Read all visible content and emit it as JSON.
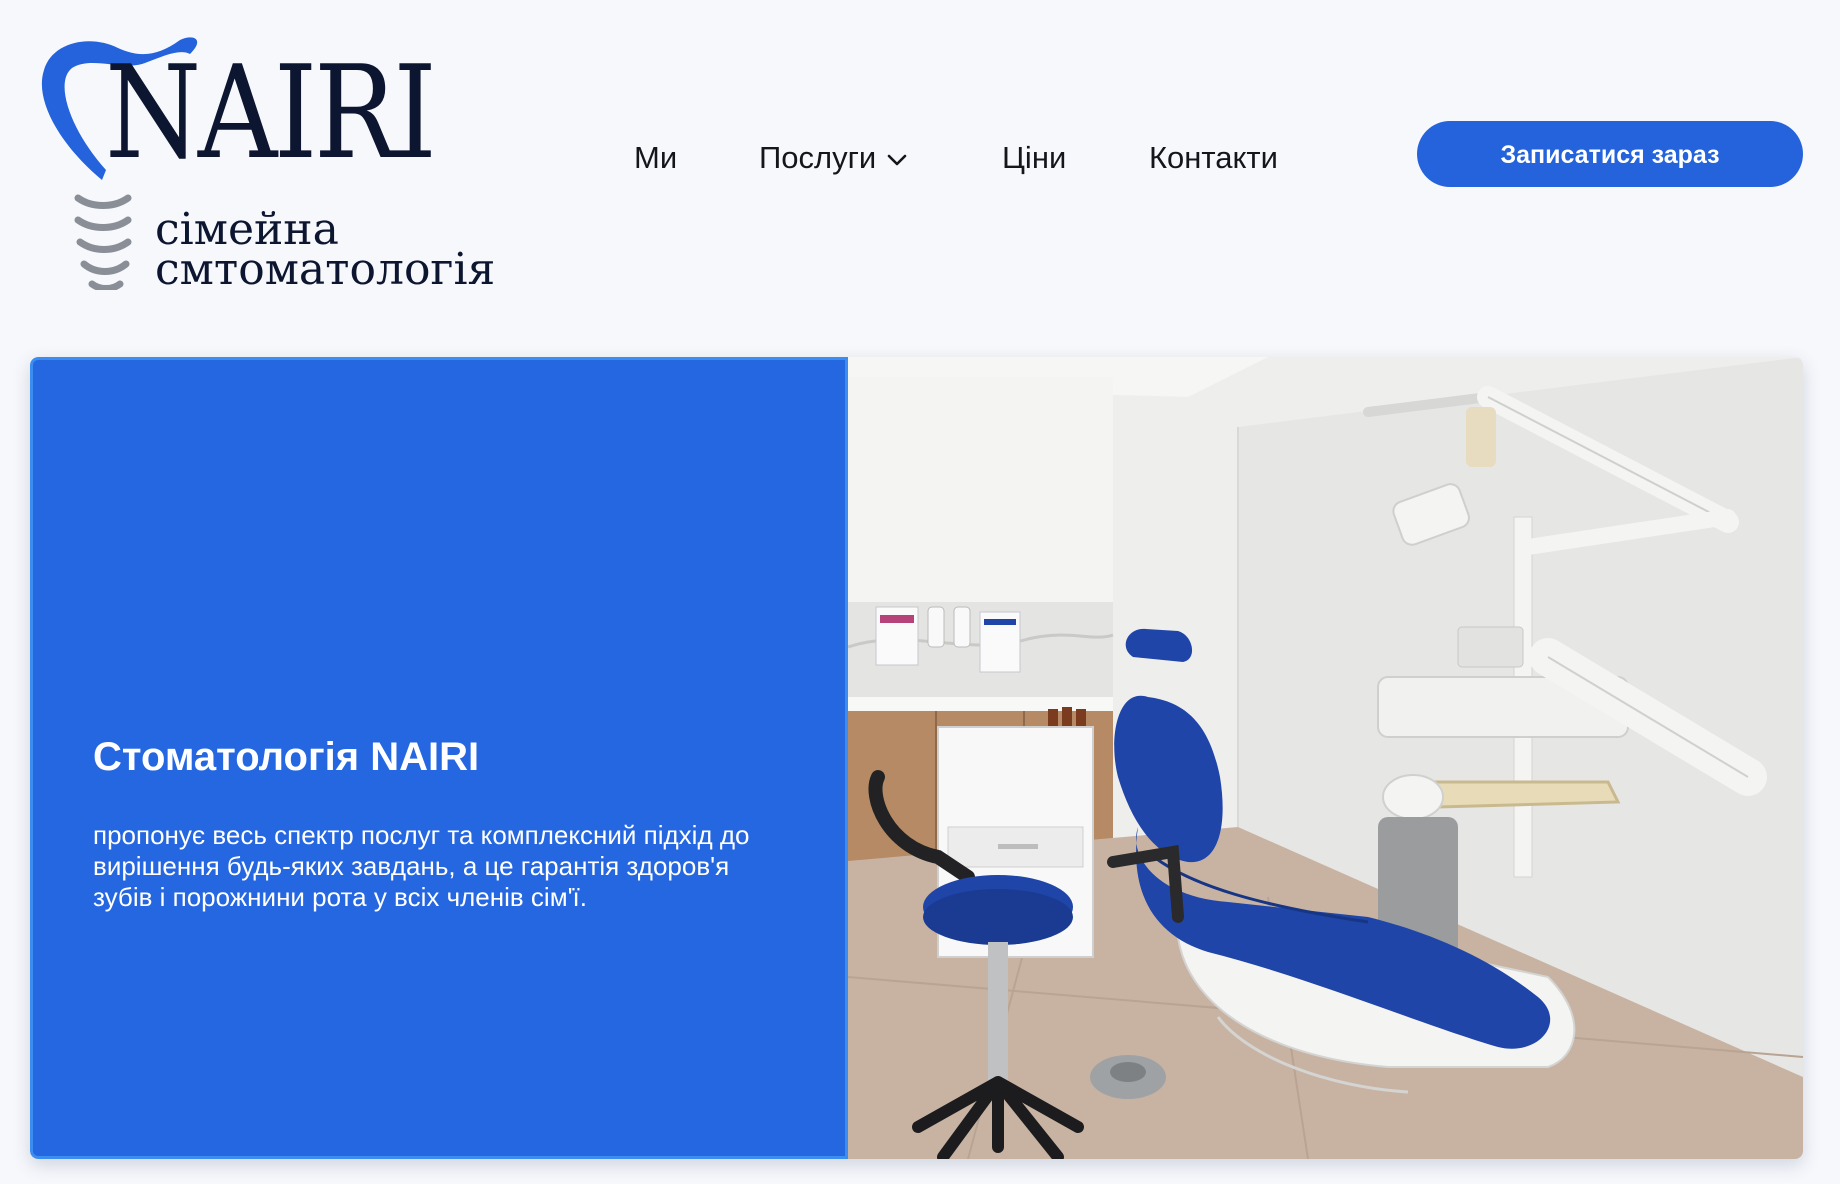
{
  "brand": {
    "name": "NAIRI",
    "subtitle_line1": "сімейна",
    "subtitle_line2": "смтоматологія"
  },
  "nav": {
    "items": [
      {
        "label": "Ми"
      },
      {
        "label": "Послуги",
        "icon": "chevron-down-icon"
      },
      {
        "label": "Ціни"
      },
      {
        "label": "Контакти"
      }
    ]
  },
  "cta": {
    "label": "Записатися зараз"
  },
  "hero": {
    "title": "Стоматологія NAIRI",
    "description": "пропонує весь спектр послуг та комплексний підхід до вирішення будь-яких завдань, а це гарантія здоров'я зубів і порожнини рота у всіх членів сім'ї.",
    "image": "dental-office-photo"
  },
  "colors": {
    "accent": "#2463db",
    "hero_panel": "#2567e1",
    "text_dark": "#0d1630",
    "background": "#f7f8fc",
    "chair_blue": "#1f45a8"
  }
}
